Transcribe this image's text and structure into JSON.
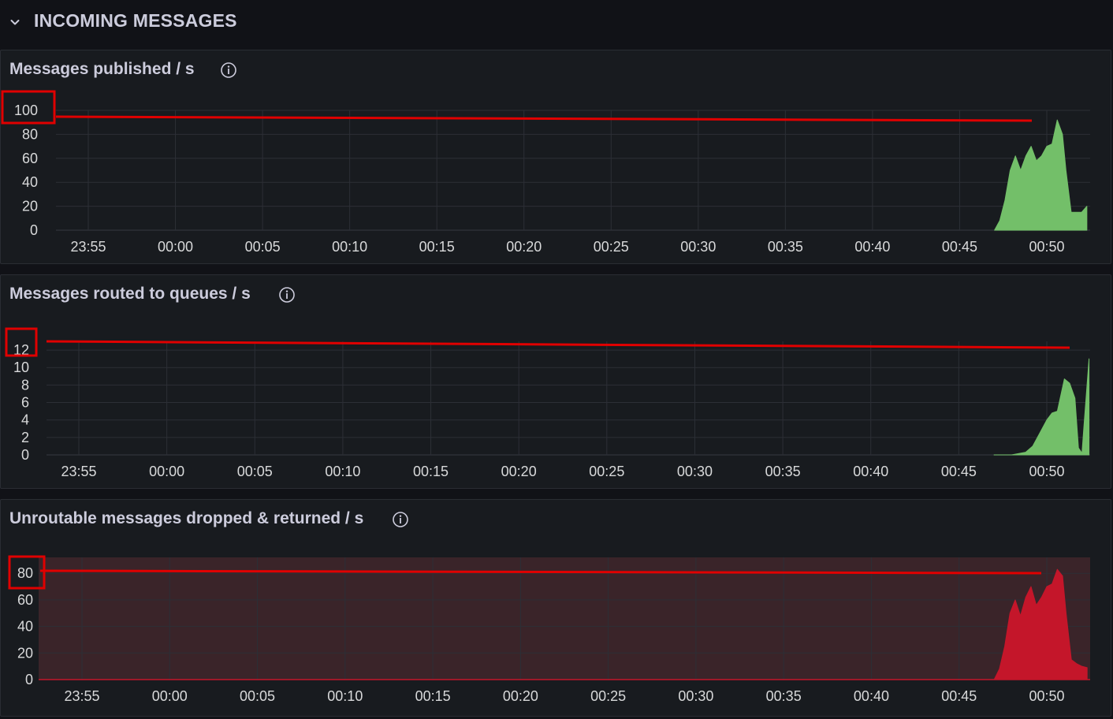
{
  "row": {
    "title": "INCOMING MESSAGES",
    "chevron_icon": "chevron-down-icon"
  },
  "x_ticks": [
    "23:55",
    "00:00",
    "00:05",
    "00:10",
    "00:15",
    "00:20",
    "00:25",
    "00:30",
    "00:35",
    "00:40",
    "00:45",
    "00:50"
  ],
  "colors": {
    "background": "#111217",
    "panel": "#181b1f",
    "grid": "#2a2d33",
    "green_fill": "#73bf69",
    "red_fill": "#c4162a",
    "red_bg": "#3a2429",
    "annotation": "#e00000"
  },
  "chart_data": [
    {
      "type": "area",
      "title": "Messages published / s",
      "info_icon": "info-icon",
      "color": "#73bf69",
      "y_ticks": [
        0,
        20,
        40,
        60,
        80,
        100
      ],
      "ylim": [
        0,
        100
      ],
      "x_start": "23:52",
      "x_end": "00:52",
      "highlighted_tick": "100",
      "x": [
        "00:47",
        "00:47.3",
        "00:47.6",
        "00:47.9",
        "00:48.2",
        "00:48.5",
        "00:48.8",
        "00:49.1",
        "00:49.4",
        "00:49.7",
        "00:50.0",
        "00:50.3",
        "00:50.6",
        "00:50.9",
        "00:51.1",
        "00:51.4",
        "00:51.7",
        "00:52.0",
        "00:52.3"
      ],
      "values": [
        0,
        8,
        25,
        50,
        62,
        50,
        62,
        70,
        58,
        62,
        70,
        72,
        92,
        80,
        50,
        15,
        15,
        15,
        20
      ]
    },
    {
      "type": "area",
      "title": "Messages routed to queues / s",
      "info_icon": "info-icon",
      "color": "#73bf69",
      "y_ticks": [
        0,
        2,
        4,
        6,
        8,
        10,
        12
      ],
      "ylim": [
        0,
        13
      ],
      "x_start": "23:52",
      "x_end": "00:52",
      "highlighted_tick": "12",
      "x": [
        "00:47",
        "00:48",
        "00:48.8",
        "00:49.2",
        "00:49.6",
        "00:50.0",
        "00:50.3",
        "00:50.6",
        "00:51.0",
        "00:51.3",
        "00:51.6",
        "00:51.8",
        "00:52.0",
        "00:52.1",
        "00:52.4"
      ],
      "values": [
        0,
        0,
        0.3,
        1,
        2.5,
        4,
        4.8,
        5,
        8.7,
        8.2,
        6.5,
        0.8,
        0.2,
        3,
        11
      ]
    },
    {
      "type": "area",
      "title": "Unroutable messages dropped & returned / s",
      "info_icon": "info-icon",
      "color": "#c4162a",
      "y_ticks": [
        0,
        20,
        40,
        60,
        80
      ],
      "ylim": [
        0,
        92
      ],
      "x_start": "23:52",
      "x_end": "00:52",
      "highlighted_tick": "80",
      "x": [
        "00:47",
        "00:47.3",
        "00:47.6",
        "00:47.9",
        "00:48.2",
        "00:48.5",
        "00:48.8",
        "00:49.1",
        "00:49.4",
        "00:49.7",
        "00:50.0",
        "00:50.3",
        "00:50.6",
        "00:50.9",
        "00:51.1",
        "00:51.4",
        "00:51.7",
        "00:52.0",
        "00:52.3"
      ],
      "values": [
        0,
        8,
        25,
        50,
        60,
        48,
        62,
        70,
        56,
        62,
        70,
        72,
        83,
        78,
        50,
        15,
        12,
        10,
        9
      ]
    }
  ]
}
